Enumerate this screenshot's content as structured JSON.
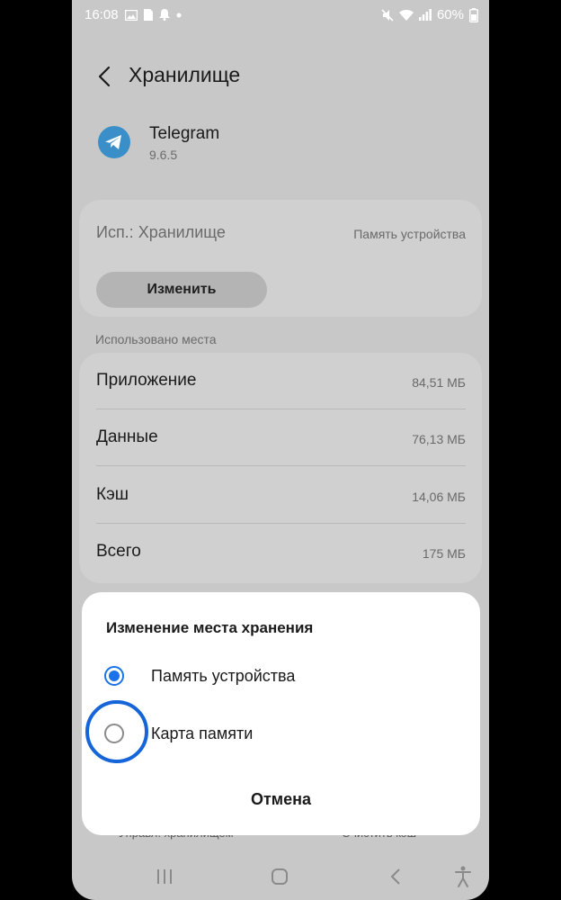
{
  "status_bar": {
    "time": "16:08",
    "battery": "60%",
    "icons_left": [
      "image-icon",
      "sim-icon",
      "bell-icon",
      "dot-icon"
    ],
    "icons_right": [
      "mute-icon",
      "wifi-icon",
      "signal-icon",
      "battery-icon"
    ]
  },
  "header": {
    "title": "Хранилище"
  },
  "app": {
    "name": "Telegram",
    "version": "9.6.5",
    "icon_color": "#3a8fc8"
  },
  "storage_location": {
    "label": "Исп.: Хранилище",
    "value": "Память устройства",
    "change_button": "Изменить"
  },
  "usage": {
    "section_label": "Использовано места",
    "rows": [
      {
        "label": "Приложение",
        "value": "84,51 МБ"
      },
      {
        "label": "Данные",
        "value": "76,13 МБ"
      },
      {
        "label": "Кэш",
        "value": "14,06 МБ"
      },
      {
        "label": "Всего",
        "value": "175 МБ"
      }
    ]
  },
  "bottom_actions": {
    "manage": "Управл. хранилищем",
    "clear_cache": "Очистить кэш"
  },
  "dialog": {
    "title": "Изменение места хранения",
    "options": [
      {
        "label": "Память устройства",
        "selected": true
      },
      {
        "label": "Карта памяти",
        "selected": false
      }
    ],
    "cancel": "Отмена"
  },
  "colors": {
    "accent": "#1a73e8",
    "highlight": "#1565d8",
    "background": "#c8c8c8"
  }
}
